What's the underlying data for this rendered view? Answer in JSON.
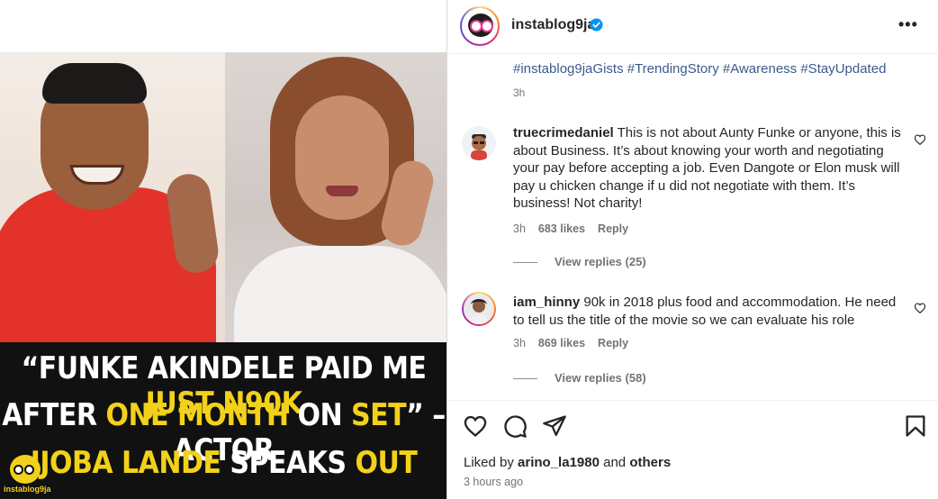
{
  "post": {
    "username": "instablog9ja",
    "verified": true,
    "accent_color": "#0095f6",
    "tag_color": "#3b5b8c",
    "caption_tags": "#instablog9jaGists #TrendingStory #Awareness #StayUpdated",
    "caption_time": "3h",
    "more_icon": "more-horizontal-icon"
  },
  "media": {
    "headline_lines": [
      [
        {
          "t": "“FUNKE AKINDELE",
          "y": false
        },
        {
          "t": " PAID ME ",
          "y": false
        },
        {
          "t": "JUST N90K",
          "y": true
        }
      ],
      [
        {
          "t": "AFTER ",
          "y": false
        },
        {
          "t": "ONE MONTH",
          "y": true
        },
        {
          "t": " ON ",
          "y": false
        },
        {
          "t": "SET",
          "y": true
        },
        {
          "t": "” – ACTOR",
          "y": false
        }
      ],
      [
        {
          "t": "IJOBA LANDE",
          "y": true
        },
        {
          "t": " SPEAKS ",
          "y": false
        },
        {
          "t": "OUT",
          "y": true
        }
      ]
    ],
    "highlight_color": "#f2d11a",
    "watermark": "instablog9ja"
  },
  "comments": [
    {
      "username": "truecrimedaniel",
      "text": "This is not about Aunty Funke or anyone, this is about Business. It’s about knowing your worth and negotiating your pay before accepting a job. Even Dangote or Elon musk will pay u chicken change if u did not negotiate with them. It’s business! Not charity!",
      "time": "3h",
      "likes": "683 likes",
      "reply_label": "Reply",
      "view_replies": "View replies (25)"
    },
    {
      "username": "iam_hinny",
      "text": "90k in 2018 plus food and accommodation. He need to tell us the title of the movie so we can evaluate his role",
      "time": "3h",
      "likes": "869 likes",
      "reply_label": "Reply",
      "view_replies": "View replies (58)"
    }
  ],
  "actions": {
    "icons": [
      "heart-icon",
      "comment-icon",
      "share-icon",
      "bookmark-icon"
    ],
    "liked_by_prefix": "Liked by",
    "liked_by_user": "arino_la1980",
    "liked_by_and": "and",
    "liked_by_others": "others",
    "post_time": "3 hours ago"
  }
}
